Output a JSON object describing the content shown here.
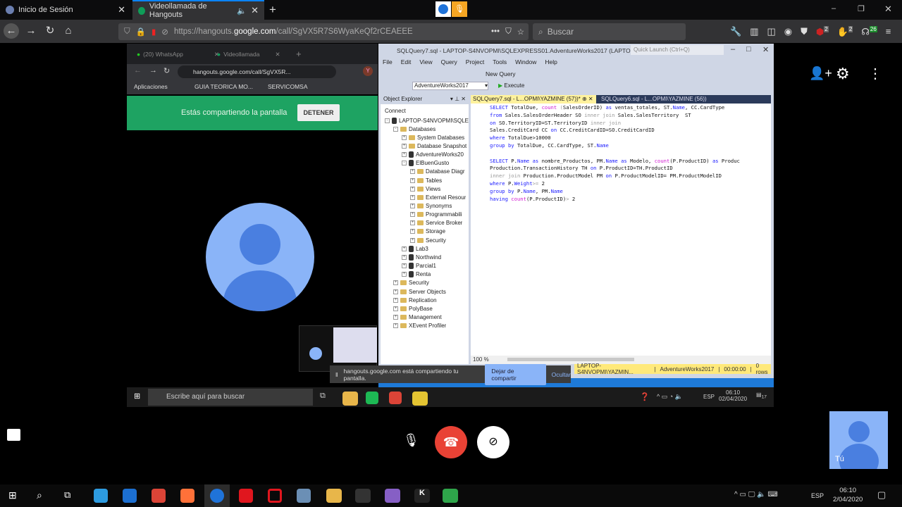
{
  "browser": {
    "tabs": [
      {
        "label": "Inicio de Sesión"
      },
      {
        "label": "Videollamada de Hangouts"
      }
    ],
    "url_prefix": "https://hangouts.",
    "url_domain": "google.com",
    "url_path": "/call/SgVX5R7S6WyaKeQf2rCEAEEE",
    "search_placeholder": "Buscar",
    "badges": {
      "ublock": "2",
      "ext2": "2",
      "ext3": "26"
    }
  },
  "shared": {
    "chrome": {
      "tabs": [
        {
          "label": "(20) WhatsApp"
        },
        {
          "label": "Videollamada"
        }
      ],
      "url": "hangouts.google.com/call/SgVX5R...",
      "bookmarks": [
        "Aplicaciones",
        "GUIA TEORICA MO...",
        "SERVICOMSA"
      ],
      "avatar_letter": "Y",
      "share_text": "Estás compartiendo la pantalla",
      "stop_label": "DETENER"
    },
    "ssms": {
      "title": "SQLQuery7.sql - LAPTOP-S4NVOPMI\\SQLEXPRESS01.AdventureWorks2017 (LAPTOP-S4NV...",
      "quick_launch": "Quick Launch (Ctrl+Q)",
      "menu": [
        "File",
        "Edit",
        "View",
        "Query",
        "Project",
        "Tools",
        "Window",
        "Help"
      ],
      "new_query": "New Query",
      "database": "AdventureWorks2017",
      "execute": "Execute",
      "object_explorer": "Object Explorer",
      "connect": "Connect",
      "tree": [
        {
          "label": "LAPTOP-S4NVOPMI\\SQLE",
          "level": 0,
          "icon": "server",
          "exp": "-"
        },
        {
          "label": "Databases",
          "level": 1,
          "icon": "folder",
          "exp": "-"
        },
        {
          "label": "System Databases",
          "level": 2,
          "icon": "folder",
          "exp": "+"
        },
        {
          "label": "Database Snapshot",
          "level": 2,
          "icon": "folder",
          "exp": "+"
        },
        {
          "label": "AdventureWorks20",
          "level": 2,
          "icon": "db",
          "exp": "+"
        },
        {
          "label": "ElBuenGusto",
          "level": 2,
          "icon": "db",
          "exp": "-"
        },
        {
          "label": "Database Diagr",
          "level": 3,
          "icon": "folder",
          "exp": "+"
        },
        {
          "label": "Tables",
          "level": 3,
          "icon": "folder",
          "exp": "+"
        },
        {
          "label": "Views",
          "level": 3,
          "icon": "folder",
          "exp": "+"
        },
        {
          "label": "External Resour",
          "level": 3,
          "icon": "folder",
          "exp": "+"
        },
        {
          "label": "Synonyms",
          "level": 3,
          "icon": "folder",
          "exp": "+"
        },
        {
          "label": "Programmabili",
          "level": 3,
          "icon": "folder",
          "exp": "+"
        },
        {
          "label": "Service Broker",
          "level": 3,
          "icon": "folder",
          "exp": "+"
        },
        {
          "label": "Storage",
          "level": 3,
          "icon": "folder",
          "exp": "+"
        },
        {
          "label": "Security",
          "level": 3,
          "icon": "folder",
          "exp": "+"
        },
        {
          "label": "Lab3",
          "level": 2,
          "icon": "db",
          "exp": "+"
        },
        {
          "label": "Northwind",
          "level": 2,
          "icon": "db",
          "exp": "+"
        },
        {
          "label": "Parcial1",
          "level": 2,
          "icon": "db",
          "exp": "+"
        },
        {
          "label": "Renta",
          "level": 2,
          "icon": "db",
          "exp": "+"
        },
        {
          "label": "Security",
          "level": 1,
          "icon": "folder",
          "exp": "+"
        },
        {
          "label": "Server Objects",
          "level": 1,
          "icon": "folder",
          "exp": "+"
        },
        {
          "label": "Replication",
          "level": 1,
          "icon": "folder",
          "exp": "+"
        },
        {
          "label": "PolyBase",
          "level": 1,
          "icon": "folder",
          "exp": "+"
        },
        {
          "label": "Management",
          "level": 1,
          "icon": "folder",
          "exp": "+"
        },
        {
          "label": "XEvent Profiler",
          "level": 1,
          "icon": "profiler",
          "exp": "+"
        }
      ],
      "doc_tabs": [
        {
          "label": "SQLQuery7.sql - L...OPMI\\YAZMINE (57))*"
        },
        {
          "label": "SQLQuery6.sql - L...OPMI\\YAZMINE (56))"
        }
      ],
      "code": [
        [
          [
            "kw",
            "SELECT"
          ],
          [
            "",
            "TotalDue, "
          ],
          [
            "fn",
            "count"
          ],
          [
            "gr",
            " ("
          ],
          [
            "",
            "SalesOrderID) "
          ],
          [
            "kw",
            "as"
          ],
          [
            "",
            "ventas_totales, ST."
          ],
          [
            "kw",
            "Name"
          ],
          [
            "",
            ", CC.CardType"
          ]
        ],
        [
          [
            "kw",
            "from"
          ],
          [
            "",
            "Sales.SalesOrderHeader SO "
          ],
          [
            "gr",
            "inner join"
          ],
          [
            "",
            "Sales.SalesTerritory  ST"
          ]
        ],
        [
          [
            "kw",
            "on"
          ],
          [
            "",
            "SO.TerritoryID=ST.TerritoryID "
          ],
          [
            "gr",
            "inner join"
          ]
        ],
        [
          [
            "",
            "Sales.CreditCard CC "
          ],
          [
            "kw",
            "on"
          ],
          [
            "",
            "CC.CreditCardID=SO.CreditCardID"
          ]
        ],
        [
          [
            "kw",
            "where"
          ],
          [
            "",
            "TotalDue>10000"
          ]
        ],
        [
          [
            "kw",
            "group by"
          ],
          [
            "",
            "TotalDue, CC.CardType, ST."
          ],
          [
            "kw",
            "Name"
          ]
        ],
        [],
        [
          [
            "kw",
            "SELECT"
          ],
          [
            "",
            "P."
          ],
          [
            "kw",
            "Name"
          ],
          [
            "kw",
            " as"
          ],
          [
            "",
            "nombre_Productos, PM."
          ],
          [
            "kw",
            "Name"
          ],
          [
            "kw",
            " as"
          ],
          [
            "",
            "Modelo, "
          ],
          [
            "fn",
            "count"
          ],
          [
            "",
            "(P.ProductID) "
          ],
          [
            "kw",
            "as"
          ],
          [
            "",
            "Produc"
          ]
        ],
        [
          [
            "",
            "Production.TransactionHistory TH "
          ],
          [
            "kw",
            "on"
          ],
          [
            "",
            "P.ProductID=TH.ProductID"
          ]
        ],
        [
          [
            "gr",
            "inner join"
          ],
          [
            "",
            "Production.ProductModel PM "
          ],
          [
            "kw",
            "on"
          ],
          [
            "",
            "P.ProductModelID= PM.ProductModelID"
          ]
        ],
        [
          [
            "kw",
            "where"
          ],
          [
            "",
            "P."
          ],
          [
            "kw",
            "Weight"
          ],
          [
            "gr",
            ">="
          ],
          [
            "",
            "2"
          ]
        ],
        [
          [
            "kw",
            "group by"
          ],
          [
            "",
            "P."
          ],
          [
            "kw",
            "Name"
          ],
          [
            "",
            ", PM."
          ],
          [
            "kw",
            "Name"
          ]
        ],
        [
          [
            "kw",
            "having"
          ],
          [
            "fn",
            "count"
          ],
          [
            "",
            "(P.ProductID)"
          ],
          [
            "gr",
            ">"
          ],
          [
            "",
            "2"
          ]
        ]
      ],
      "zoom": "100 %",
      "status": {
        "server": "LAPTOP-S4NVOPMI\\YAZMIN...",
        "db": "AdventureWorks2017",
        "time": "00:00:00",
        "rows": "0 rows"
      }
    },
    "notification": {
      "text": "hangouts.google.com está compartiendo tu pantalla.",
      "stop": "Dejar de compartir",
      "hide": "Ocultar"
    },
    "taskbar": {
      "search": "Escribe aquí para buscar",
      "lang": "ESP",
      "time": "06:10",
      "date": "02/04/2020",
      "notif_count": "17"
    }
  },
  "self_view_label": "Tú",
  "taskbar": {
    "lang": "ESP",
    "time": "06:10",
    "date": "2/04/2020"
  },
  "colors": {
    "hangup": "#e94235",
    "share_green": "#1ea362",
    "avatar": "#8ab4f8",
    "avatar_fg": "#4a7fe0",
    "status_yellow": "#ffe97a"
  }
}
